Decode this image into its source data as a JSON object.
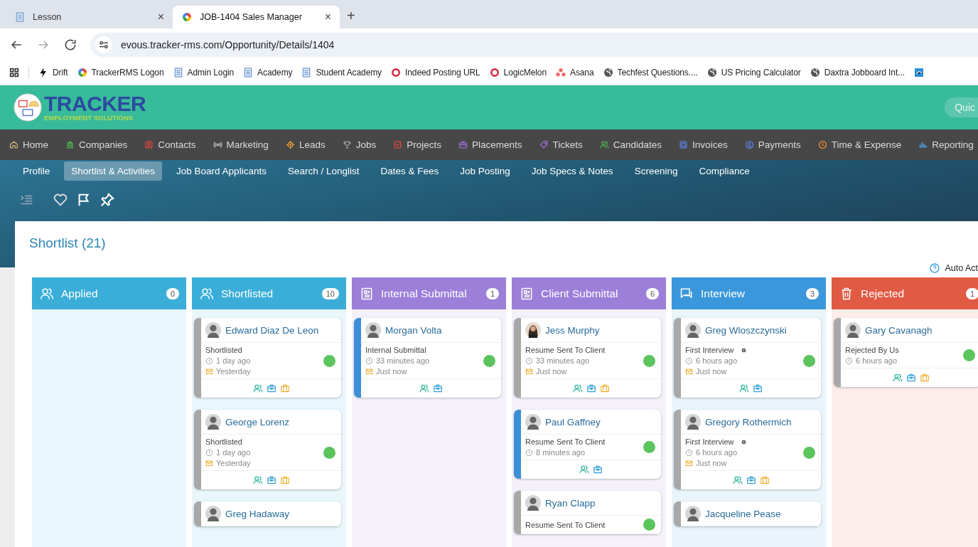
{
  "browser": {
    "tabs": [
      {
        "title": "Lesson",
        "close": "×",
        "selected": false
      },
      {
        "title": "JOB-1404 Sales Manager",
        "close": "×",
        "selected": true
      }
    ],
    "new_tab": "+",
    "url": "evous.tracker-rms.com/Opportunity/Details/1404",
    "bookmarks": [
      {
        "label": "Drift"
      },
      {
        "label": "TrackerRMS Logon"
      },
      {
        "label": "Admin Login"
      },
      {
        "label": "Academy"
      },
      {
        "label": "Student Academy"
      },
      {
        "label": "Indeed Posting URL"
      },
      {
        "label": "LogicMelon"
      },
      {
        "label": "Asana"
      },
      {
        "label": "Techfest Questions...."
      },
      {
        "label": "US Pricing Calculator"
      },
      {
        "label": "Daxtra Jobboard Int..."
      }
    ]
  },
  "header": {
    "logo_title": "TRACKER",
    "logo_subtitle": "EMPLOYMENT SOLUTIONS",
    "quick_button": "Quic"
  },
  "main_nav": [
    {
      "label": "Home"
    },
    {
      "label": "Companies"
    },
    {
      "label": "Contacts"
    },
    {
      "label": "Marketing"
    },
    {
      "label": "Leads"
    },
    {
      "label": "Jobs"
    },
    {
      "label": "Projects"
    },
    {
      "label": "Placements"
    },
    {
      "label": "Tickets"
    },
    {
      "label": "Candidates"
    },
    {
      "label": "Invoices"
    },
    {
      "label": "Payments"
    },
    {
      "label": "Time & Expense"
    },
    {
      "label": "Reporting"
    }
  ],
  "sub_tabs": [
    {
      "label": "Profile",
      "selected": false
    },
    {
      "label": "Shortlist & Activities",
      "selected": true
    },
    {
      "label": "Job Board Applicants",
      "selected": false
    },
    {
      "label": "Search / Longlist",
      "selected": false
    },
    {
      "label": "Dates & Fees",
      "selected": false
    },
    {
      "label": "Job Posting",
      "selected": false
    },
    {
      "label": "Job Specs & Notes",
      "selected": false
    },
    {
      "label": "Screening",
      "selected": false
    },
    {
      "label": "Compliance",
      "selected": false
    }
  ],
  "page": {
    "title": "Shortlist (21)",
    "help_link": "Auto Act"
  },
  "columns": [
    {
      "title": "Applied",
      "count": "0",
      "color": "#3aaed8"
    },
    {
      "title": "Shortlisted",
      "count": "10",
      "color": "#3aaed8",
      "cards": [
        {
          "name": "Edward Diaz De Leon",
          "kind": "placeholder",
          "color": "#a8a8a8",
          "status": "Shortlisted",
          "note": false,
          "time": "1 day ago",
          "mail": "Yesterday",
          "placement": true
        },
        {
          "name": "George Lorenz",
          "kind": "placeholder",
          "color": "#a8a8a8",
          "status": "Shortlisted",
          "note": false,
          "time": "1 day ago",
          "mail": "Yesterday",
          "placement": true
        },
        {
          "name": "Greg Hadaway",
          "kind": "placeholder",
          "color": "#a8a8a8"
        }
      ]
    },
    {
      "title": "Internal Submittal",
      "count": "1",
      "color": "#9b7fd9",
      "cards": [
        {
          "name": "Morgan Volta",
          "kind": "placeholder",
          "color": "#3a8fd8",
          "status": "Internal Submittal",
          "note": false,
          "time": "33 minutes ago",
          "mail": "Just now",
          "placement": false
        }
      ]
    },
    {
      "title": "Client Submittal",
      "count": "6",
      "color": "#9b7fd9",
      "cards": [
        {
          "name": "Jess Murphy",
          "color": "#a8a8a8",
          "status": "Resume Sent To Client",
          "note": false,
          "time": "33 minutes ago",
          "mail": "Just now",
          "placement": true
        },
        {
          "name": "Paul Gaffney",
          "kind": "placeholder",
          "color": "#3a8fd8",
          "status": "Resume Sent To Client",
          "note": false,
          "time": "8 minutes ago",
          "placement": false
        },
        {
          "name": "Ryan Clapp",
          "kind": "placeholder",
          "color": "#a8a8a8",
          "status": "Resume Sent To Client",
          "note": false
        }
      ]
    },
    {
      "title": "Interview",
      "count": "3",
      "color": "#3a97dc",
      "cards": [
        {
          "name": "Greg Wloszczynski",
          "kind": "placeholder",
          "color": "#a8a8a8",
          "status": "First Interview",
          "note": true,
          "time": "6 hours ago",
          "mail": "Just now",
          "placement": false
        },
        {
          "name": "Gregory Rothermich",
          "kind": "placeholder",
          "color": "#a8a8a8",
          "status": "First Interview",
          "note": true,
          "time": "6 hours ago",
          "mail": "Just now",
          "placement": true
        },
        {
          "name": "Jacqueline Pease",
          "kind": "placeholder",
          "color": "#a8a8a8"
        }
      ]
    },
    {
      "title": "Rejected",
      "count": "1",
      "color": "#e05a44",
      "cards": [
        {
          "name": "Gary Cavanagh",
          "kind": "placeholder",
          "color": "#a8a8a8",
          "status": "Rejected By Us",
          "note": false,
          "time": "6 hours ago",
          "placement": true
        }
      ]
    }
  ]
}
